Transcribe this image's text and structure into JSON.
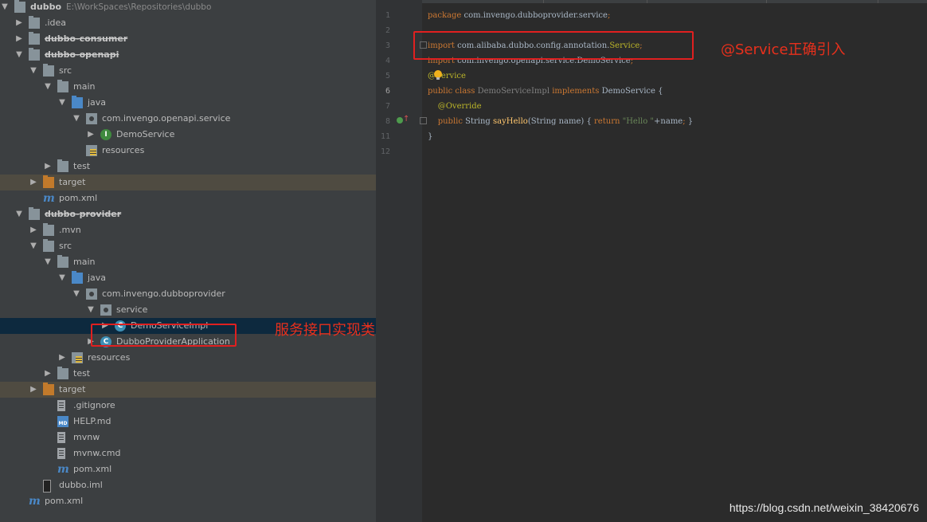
{
  "project_tree": [
    {
      "label": "dubbo",
      "path": "E:\\WorkSpaces\\Repositories\\dubbo",
      "depth": 0,
      "expanded": true,
      "icon": "module-folder-icon",
      "bold": true
    },
    {
      "label": ".idea",
      "depth": 1,
      "expanded": false,
      "icon": "folder-icon"
    },
    {
      "label": "dubbo-consumer",
      "depth": 1,
      "expanded": false,
      "icon": "module-folder-icon",
      "bold": true,
      "strike": true
    },
    {
      "label": "dubbo-openapi",
      "depth": 1,
      "expanded": true,
      "icon": "module-folder-icon",
      "bold": true,
      "strike": true
    },
    {
      "label": "src",
      "depth": 2,
      "expanded": true,
      "icon": "folder-icon"
    },
    {
      "label": "main",
      "depth": 3,
      "expanded": true,
      "icon": "folder-icon"
    },
    {
      "label": "java",
      "depth": 4,
      "expanded": true,
      "icon": "source-folder-icon"
    },
    {
      "label": "com.invengo.openapi.service",
      "depth": 5,
      "expanded": true,
      "icon": "package-icon"
    },
    {
      "label": "DemoService",
      "depth": 6,
      "expanded": false,
      "icon": "interface-icon"
    },
    {
      "label": "resources",
      "depth": 5,
      "icon": "resources-folder-icon"
    },
    {
      "label": "test",
      "depth": 3,
      "expanded": false,
      "icon": "folder-icon"
    },
    {
      "label": "target",
      "depth": 2,
      "expanded": false,
      "icon": "excluded-folder-icon",
      "highlight": "target"
    },
    {
      "label": "pom.xml",
      "depth": 2,
      "icon": "maven-icon"
    },
    {
      "label": "dubbo-provider",
      "depth": 1,
      "expanded": true,
      "icon": "module-folder-icon",
      "bold": true,
      "strike": true
    },
    {
      "label": ".mvn",
      "depth": 2,
      "expanded": false,
      "icon": "folder-icon"
    },
    {
      "label": "src",
      "depth": 2,
      "expanded": true,
      "icon": "folder-icon"
    },
    {
      "label": "main",
      "depth": 3,
      "expanded": true,
      "icon": "folder-icon"
    },
    {
      "label": "java",
      "depth": 4,
      "expanded": true,
      "icon": "source-folder-icon"
    },
    {
      "label": "com.invengo.dubboprovider",
      "depth": 5,
      "expanded": true,
      "icon": "package-icon"
    },
    {
      "label": "service",
      "depth": 6,
      "expanded": true,
      "icon": "package-icon"
    },
    {
      "label": "DemoServiceImpl",
      "depth": 7,
      "expanded": false,
      "icon": "class-icon",
      "selected": true
    },
    {
      "label": "DubboProviderApplication",
      "depth": 6,
      "expanded": false,
      "icon": "spring-class-icon"
    },
    {
      "label": "resources",
      "depth": 4,
      "expanded": false,
      "icon": "resources-folder-icon"
    },
    {
      "label": "test",
      "depth": 3,
      "expanded": false,
      "icon": "folder-icon"
    },
    {
      "label": "target",
      "depth": 2,
      "expanded": false,
      "icon": "excluded-folder-icon",
      "highlight": "target"
    },
    {
      "label": ".gitignore",
      "depth": 3,
      "icon": "text-file-icon"
    },
    {
      "label": "HELP.md",
      "depth": 3,
      "icon": "markdown-icon"
    },
    {
      "label": "mvnw",
      "depth": 3,
      "icon": "text-file-icon"
    },
    {
      "label": "mvnw.cmd",
      "depth": 3,
      "icon": "text-file-icon"
    },
    {
      "label": "pom.xml",
      "depth": 3,
      "icon": "maven-icon"
    },
    {
      "label": "dubbo.iml",
      "depth": 2,
      "icon": "iml-file-icon"
    },
    {
      "label": "pom.xml",
      "depth": 1,
      "icon": "maven-icon"
    }
  ],
  "editor": {
    "current_line": "6",
    "lines": [
      {
        "n": "1",
        "segs": [
          [
            "kw",
            "package "
          ],
          [
            "",
            "com.invengo.dubboprovider.service"
          ],
          [
            "kw",
            ";"
          ]
        ]
      },
      {
        "n": "2",
        "segs": []
      },
      {
        "n": "3",
        "segs": [
          [
            "kw",
            "import "
          ],
          [
            "",
            "com.alibaba.dubbo.config.annotation."
          ],
          [
            "ann",
            "Service"
          ],
          [
            "kw",
            ";"
          ]
        ]
      },
      {
        "n": "4",
        "segs": [
          [
            "kw",
            "import "
          ],
          [
            "",
            "com.invengo.openapi.service.DemoService"
          ],
          [
            "kw",
            ";"
          ]
        ]
      },
      {
        "n": "5",
        "segs": [
          [
            "ann",
            "@Service"
          ]
        ]
      },
      {
        "n": "6",
        "segs": [
          [
            "kw",
            "public class "
          ],
          [
            "unused",
            "DemoServiceImpl "
          ],
          [
            "kw",
            "implements "
          ],
          [
            "",
            "DemoService {"
          ]
        ]
      },
      {
        "n": "7",
        "segs": [
          [
            "",
            "    "
          ],
          [
            "ann",
            "@Override"
          ]
        ]
      },
      {
        "n": "8",
        "segs": [
          [
            "",
            "    "
          ],
          [
            "kw",
            "public "
          ],
          [
            "",
            "String "
          ],
          [
            "fn",
            "sayHello"
          ],
          [
            "",
            "(String name) { "
          ],
          [
            "kw",
            "return "
          ],
          [
            "str",
            "\"Hello \""
          ],
          [
            "",
            "+name"
          ],
          [
            "kw",
            "; "
          ],
          [
            "",
            "}"
          ]
        ]
      },
      {
        "n": "11",
        "segs": [
          [
            "",
            "}"
          ]
        ]
      },
      {
        "n": "12",
        "segs": []
      }
    ]
  },
  "annotations": {
    "import_note": "@Service正确引入",
    "impl_note": "服务接口实现类"
  },
  "watermark": "https://blog.csdn.net/weixin_38420676"
}
